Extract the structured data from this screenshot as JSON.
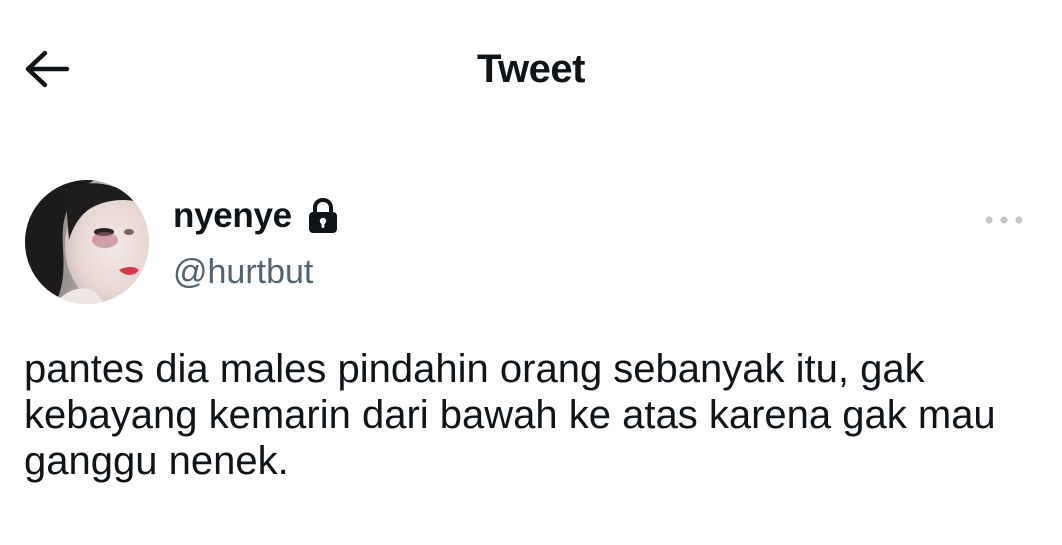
{
  "header": {
    "title": "Tweet",
    "back_icon": "arrow-left-icon"
  },
  "author": {
    "display_name": "nyenye",
    "handle": "@hurtbut",
    "protected_icon": "lock-icon",
    "avatar": "profile-photo"
  },
  "actions": {
    "more_icon": "more-horizontal-icon"
  },
  "tweet": {
    "text": "pantes dia males pindahin orang sebanyak itu, gak kebayang kemarin dari bawah ke atas karena gak mau ganggu nenek."
  },
  "colors": {
    "text_primary": "#0f1419",
    "text_secondary": "#536471",
    "icon_muted": "#c4c9cd",
    "background": "#ffffff"
  }
}
